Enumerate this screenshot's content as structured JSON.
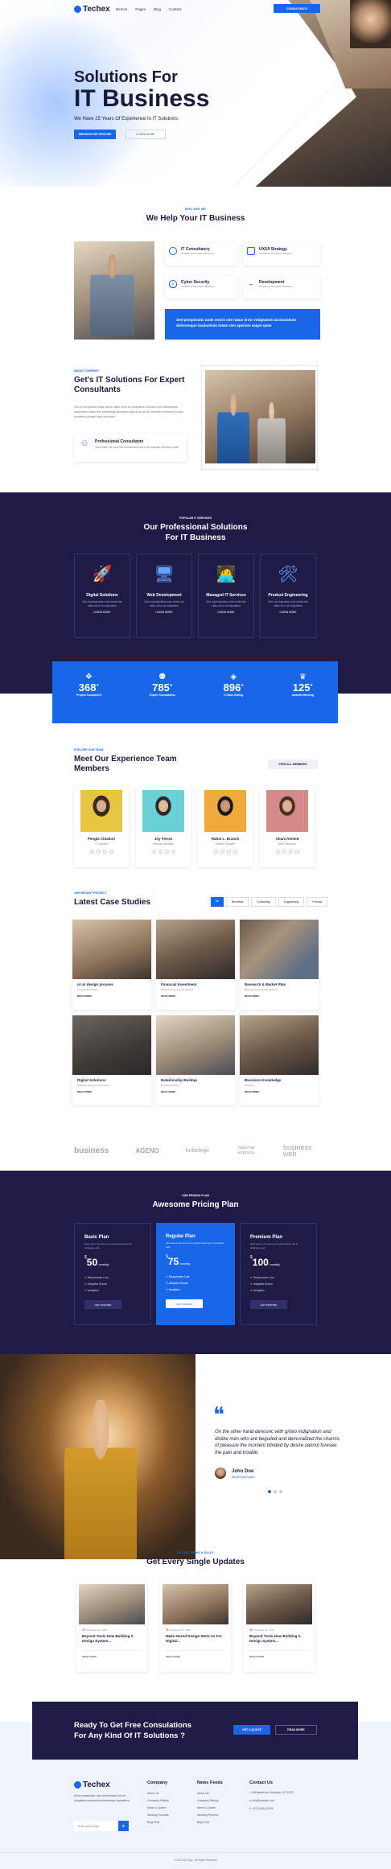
{
  "nav": {
    "brand": "Techex",
    "items": [
      "Demos",
      "Pages",
      "Blog",
      "Contact"
    ],
    "cta": "CONSULTANCY"
  },
  "hero": {
    "title1": "Solutions For",
    "title2": "IT Business",
    "subtitle": "We Have 25 Years Of Experience In IT Solutions",
    "btn1": "SERVICES WE PROVIDE",
    "btn2": "LEARN MORE"
  },
  "help": {
    "tag": "WHO ARE WE",
    "title": "We Help Your IT Business",
    "features": [
      {
        "title": "IT Consultancy",
        "sub": "Creative & Innovative Solutions"
      },
      {
        "title": "UX/UI Strategy",
        "sub": "Creative & Innovative Solutions"
      },
      {
        "title": "Cyber Security",
        "sub": "Creative & Innovative Solutions"
      },
      {
        "title": "Development",
        "sub": "Creative & Innovative Solutions"
      }
    ],
    "banner": "Sed perspiciatis unde omnis iste natus error voluptatem accusantium doloremque laudantium totam rem aperiam eaque quae"
  },
  "about": {
    "tag": "ABOUT COMPANY",
    "title": "Get's IT Solutions For Expert Consultants",
    "text": "Sed ut perspiciatis unde omnis natus error sit voluptatem accusan tlum doloremque laudantium totam rem aperiamaq queaquae ipsa quae ab illo inventore veritatis et quasi architecto beatae vitae dicta sunt",
    "pc_title": "Professional Consultants",
    "pc_text": "Quis autem vel eum iure reprehenderit qui in ea voluptate velit esse quam"
  },
  "services": {
    "tag": "POPULAR IT SERVICES",
    "title1": "Our Professional Solutions",
    "title2": "For IT Business",
    "items": [
      {
        "title": "Digital Solutions",
        "text": "Sed ut perspiciatis unde omnis iste natus error sit voluptatem"
      },
      {
        "title": "Web Development",
        "text": "Sed ut perspiciatis unde omnis iste natus error sit voluptatem"
      },
      {
        "title": "Managed IT Services",
        "text": "Sed ut perspiciatis unde omnis iste natus error sit voluptatem"
      },
      {
        "title": "Product Engineering",
        "text": "Sed ut perspiciatis unde omnis iste natus error sit voluptatem"
      }
    ],
    "more": "LEARN MORE"
  },
  "stats": [
    {
      "num": "368",
      "label": "Project Completed"
    },
    {
      "num": "785",
      "label": "Expert Consultants"
    },
    {
      "num": "896",
      "label": "5 Stars Rating"
    },
    {
      "num": "125",
      "label": "Awards Winning"
    }
  ],
  "team": {
    "tag": "EXPLORE OUR TEAM",
    "title1": "Meet Our Experience Team",
    "title2": "Members",
    "btn": "VIEW ALL MEMBERS",
    "members": [
      {
        "name": "Pengla Chiaburi",
        "role": "IT Engineer"
      },
      {
        "name": "Joy Flores",
        "role": "Business Manager"
      },
      {
        "name": "Rahul L. Branch",
        "role": "Graphic Designer"
      },
      {
        "name": "Abani Ahmed",
        "role": "Web Developer"
      }
    ]
  },
  "cases": {
    "tag": "OUR RECENT PROJECT",
    "title": "Latest Case Studies",
    "filters": [
      "All",
      "Business",
      "Consulting",
      "Engineering",
      "Product"
    ],
    "items": [
      {
        "title": "ui ux design process",
        "sub": "Consulting Product"
      },
      {
        "title": "Financial Investment",
        "sub": "Business Engineering Product"
      },
      {
        "title": "Research & Market Plan",
        "sub": "Business Engineering Product"
      },
      {
        "title": "Digital Solutions",
        "sub": "Business Engineering Product"
      },
      {
        "title": "Relationship Buildup",
        "sub": "Business Product"
      },
      {
        "title": "Business Knowledge",
        "sub": "Business"
      }
    ],
    "read": "READ MORE"
  },
  "brands": [
    "business",
    "AGENO",
    "furbolego",
    "national express",
    "business web"
  ],
  "pricing": {
    "tag": "OUR PRICING PLAN",
    "title": "Awesome Pricing Plan",
    "plans": [
      {
        "name": "Basic Plan",
        "desc": "Quis autem vel eum iure reprehenderit qui in voluptate velit",
        "price": "50",
        "per": "/ monthly",
        "feats": [
          "Responsive Live",
          "Adaptive Brand",
          "Analytics"
        ],
        "btn": "GET STARTED"
      },
      {
        "name": "Regular Plan",
        "desc": "Quis autem vel eum iure reprehenderit qui in voluptate velit",
        "price": "75",
        "per": "/ monthly",
        "feats": [
          "Responsive Live",
          "Adaptive Brand",
          "Analytics"
        ],
        "btn": "GET STARTED"
      },
      {
        "name": "Premium Plan",
        "desc": "Quis autem vel eum iure reprehenderit qui in voluptate velit",
        "price": "100",
        "per": "/ monthly",
        "feats": [
          "Responsive Live",
          "Adaptive Brand",
          "Analytics"
        ],
        "btn": "GET STARTED"
      }
    ]
  },
  "testimonial": {
    "quote": "On the other hand denounc with girteo indignation and dislike men who are beguiled and demoralized the charms of pleasure the moment blinded by desire cannot foresee the pain and trouble.",
    "name": "John Doe",
    "role": "WordPress Expert"
  },
  "news": {
    "tag": "LATEST NEWS & BLOG",
    "title": "Get Every Single Updates",
    "items": [
      {
        "date": "November 21, 2023",
        "title": "Beyond Tools How Building A Design System..."
      },
      {
        "date": "November 21, 2023",
        "title": "Make Hexed Design Work As For Digital..."
      },
      {
        "date": "November 21, 2023",
        "title": "Beyond Tools How Building A Design System..."
      }
    ],
    "more": "READ MORE"
  },
  "cta": {
    "title1": "Ready To Get Free Consulations",
    "title2": "For Any Kind Of IT Solutions ?",
    "btn1": "GET A QUOTE",
    "btn2": "READ MORE"
  },
  "footer": {
    "brand": "Techex",
    "about": "Sed ut perspiciatis unde omnis natus error sit voluptatem accusantium doloremque laudantium",
    "email_ph": "Enter your email",
    "company_h": "Company",
    "company": [
      "About Us",
      "Company History",
      "Need a Career",
      "Working Process",
      "Blog Post"
    ],
    "news_h": "News Feeds",
    "news": [
      "About Us",
      "Company History",
      "Need a Career",
      "Working Process",
      "Blog Post"
    ],
    "contact_h": "Contact Us",
    "contact": [
      "4 Elizabeth Ave, Brooklyn, NY, 11223",
      "info@example.com",
      "+012 (345) 678 99"
    ],
    "copy": "© 2024 All Copy . All Rights Reserved"
  }
}
